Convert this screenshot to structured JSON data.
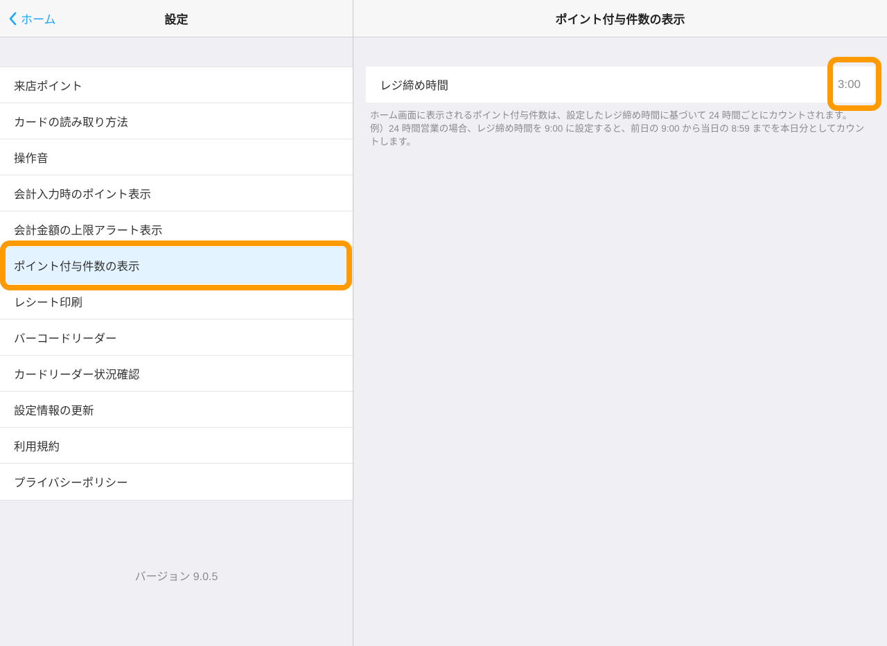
{
  "sidebar": {
    "back_label": "ホーム",
    "title": "設定",
    "items": [
      {
        "label": "来店ポイント"
      },
      {
        "label": "カードの読み取り方法"
      },
      {
        "label": "操作音"
      },
      {
        "label": "会計入力時のポイント表示"
      },
      {
        "label": "会計金額の上限アラート表示"
      },
      {
        "label": "ポイント付与件数の表示"
      },
      {
        "label": "レシート印刷"
      },
      {
        "label": "バーコードリーダー"
      },
      {
        "label": "カードリーダー状況確認"
      },
      {
        "label": "設定情報の更新"
      },
      {
        "label": "利用規約"
      },
      {
        "label": "プライバシーポリシー"
      }
    ],
    "version": "バージョン 9.0.5"
  },
  "panel": {
    "title": "ポイント付与件数の表示",
    "setting_label": "レジ締め時間",
    "setting_value": "3:00",
    "footnote_line1": "ホーム画面に表示されるポイント付与件数は、設定したレジ締め時間に基づいて 24 時間ごとにカウントされます。",
    "footnote_line2": "例）24 時間営業の場合、レジ締め時間を 9:00 に設定すると、前日の 9:00 から当日の 8:59 までを本日分としてカウントします。"
  }
}
